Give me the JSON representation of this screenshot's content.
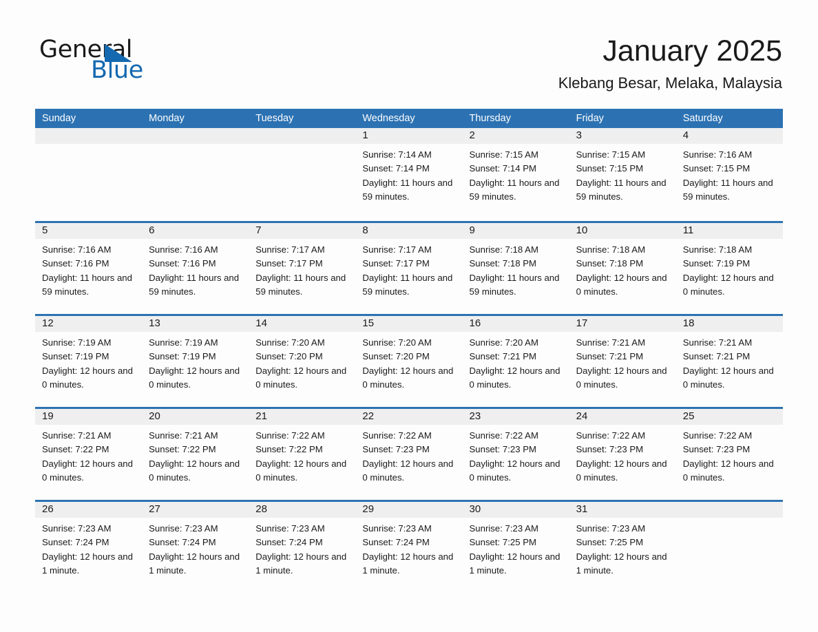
{
  "brand": {
    "name_part1": "General",
    "name_part2": "Blue",
    "triangle_icon": "triangle-icon",
    "accent_color": "#1469b0"
  },
  "header": {
    "month_title": "January 2025",
    "location": "Klebang Besar, Melaka, Malaysia"
  },
  "theme": {
    "header_blue": "#2c72b3",
    "day_band_gray": "#efefef",
    "page_background": "#fdfdfd",
    "text_color": "#1a1a1a"
  },
  "calendar": {
    "weekdays": [
      "Sunday",
      "Monday",
      "Tuesday",
      "Wednesday",
      "Thursday",
      "Friday",
      "Saturday"
    ],
    "weeks": [
      [
        {
          "day": "",
          "sunrise": "",
          "sunset": "",
          "daylight": "",
          "empty": true
        },
        {
          "day": "",
          "sunrise": "",
          "sunset": "",
          "daylight": "",
          "empty": true
        },
        {
          "day": "",
          "sunrise": "",
          "sunset": "",
          "daylight": "",
          "empty": true
        },
        {
          "day": "1",
          "sunrise": "Sunrise: 7:14 AM",
          "sunset": "Sunset: 7:14 PM",
          "daylight": "Daylight: 11 hours and 59 minutes.",
          "empty": false
        },
        {
          "day": "2",
          "sunrise": "Sunrise: 7:15 AM",
          "sunset": "Sunset: 7:14 PM",
          "daylight": "Daylight: 11 hours and 59 minutes.",
          "empty": false
        },
        {
          "day": "3",
          "sunrise": "Sunrise: 7:15 AM",
          "sunset": "Sunset: 7:15 PM",
          "daylight": "Daylight: 11 hours and 59 minutes.",
          "empty": false
        },
        {
          "day": "4",
          "sunrise": "Sunrise: 7:16 AM",
          "sunset": "Sunset: 7:15 PM",
          "daylight": "Daylight: 11 hours and 59 minutes.",
          "empty": false
        }
      ],
      [
        {
          "day": "5",
          "sunrise": "Sunrise: 7:16 AM",
          "sunset": "Sunset: 7:16 PM",
          "daylight": "Daylight: 11 hours and 59 minutes.",
          "empty": false
        },
        {
          "day": "6",
          "sunrise": "Sunrise: 7:16 AM",
          "sunset": "Sunset: 7:16 PM",
          "daylight": "Daylight: 11 hours and 59 minutes.",
          "empty": false
        },
        {
          "day": "7",
          "sunrise": "Sunrise: 7:17 AM",
          "sunset": "Sunset: 7:17 PM",
          "daylight": "Daylight: 11 hours and 59 minutes.",
          "empty": false
        },
        {
          "day": "8",
          "sunrise": "Sunrise: 7:17 AM",
          "sunset": "Sunset: 7:17 PM",
          "daylight": "Daylight: 11 hours and 59 minutes.",
          "empty": false
        },
        {
          "day": "9",
          "sunrise": "Sunrise: 7:18 AM",
          "sunset": "Sunset: 7:18 PM",
          "daylight": "Daylight: 11 hours and 59 minutes.",
          "empty": false
        },
        {
          "day": "10",
          "sunrise": "Sunrise: 7:18 AM",
          "sunset": "Sunset: 7:18 PM",
          "daylight": "Daylight: 12 hours and 0 minutes.",
          "empty": false
        },
        {
          "day": "11",
          "sunrise": "Sunrise: 7:18 AM",
          "sunset": "Sunset: 7:19 PM",
          "daylight": "Daylight: 12 hours and 0 minutes.",
          "empty": false
        }
      ],
      [
        {
          "day": "12",
          "sunrise": "Sunrise: 7:19 AM",
          "sunset": "Sunset: 7:19 PM",
          "daylight": "Daylight: 12 hours and 0 minutes.",
          "empty": false
        },
        {
          "day": "13",
          "sunrise": "Sunrise: 7:19 AM",
          "sunset": "Sunset: 7:19 PM",
          "daylight": "Daylight: 12 hours and 0 minutes.",
          "empty": false
        },
        {
          "day": "14",
          "sunrise": "Sunrise: 7:20 AM",
          "sunset": "Sunset: 7:20 PM",
          "daylight": "Daylight: 12 hours and 0 minutes.",
          "empty": false
        },
        {
          "day": "15",
          "sunrise": "Sunrise: 7:20 AM",
          "sunset": "Sunset: 7:20 PM",
          "daylight": "Daylight: 12 hours and 0 minutes.",
          "empty": false
        },
        {
          "day": "16",
          "sunrise": "Sunrise: 7:20 AM",
          "sunset": "Sunset: 7:21 PM",
          "daylight": "Daylight: 12 hours and 0 minutes.",
          "empty": false
        },
        {
          "day": "17",
          "sunrise": "Sunrise: 7:21 AM",
          "sunset": "Sunset: 7:21 PM",
          "daylight": "Daylight: 12 hours and 0 minutes.",
          "empty": false
        },
        {
          "day": "18",
          "sunrise": "Sunrise: 7:21 AM",
          "sunset": "Sunset: 7:21 PM",
          "daylight": "Daylight: 12 hours and 0 minutes.",
          "empty": false
        }
      ],
      [
        {
          "day": "19",
          "sunrise": "Sunrise: 7:21 AM",
          "sunset": "Sunset: 7:22 PM",
          "daylight": "Daylight: 12 hours and 0 minutes.",
          "empty": false
        },
        {
          "day": "20",
          "sunrise": "Sunrise: 7:21 AM",
          "sunset": "Sunset: 7:22 PM",
          "daylight": "Daylight: 12 hours and 0 minutes.",
          "empty": false
        },
        {
          "day": "21",
          "sunrise": "Sunrise: 7:22 AM",
          "sunset": "Sunset: 7:22 PM",
          "daylight": "Daylight: 12 hours and 0 minutes.",
          "empty": false
        },
        {
          "day": "22",
          "sunrise": "Sunrise: 7:22 AM",
          "sunset": "Sunset: 7:23 PM",
          "daylight": "Daylight: 12 hours and 0 minutes.",
          "empty": false
        },
        {
          "day": "23",
          "sunrise": "Sunrise: 7:22 AM",
          "sunset": "Sunset: 7:23 PM",
          "daylight": "Daylight: 12 hours and 0 minutes.",
          "empty": false
        },
        {
          "day": "24",
          "sunrise": "Sunrise: 7:22 AM",
          "sunset": "Sunset: 7:23 PM",
          "daylight": "Daylight: 12 hours and 0 minutes.",
          "empty": false
        },
        {
          "day": "25",
          "sunrise": "Sunrise: 7:22 AM",
          "sunset": "Sunset: 7:23 PM",
          "daylight": "Daylight: 12 hours and 0 minutes.",
          "empty": false
        }
      ],
      [
        {
          "day": "26",
          "sunrise": "Sunrise: 7:23 AM",
          "sunset": "Sunset: 7:24 PM",
          "daylight": "Daylight: 12 hours and 1 minute.",
          "empty": false
        },
        {
          "day": "27",
          "sunrise": "Sunrise: 7:23 AM",
          "sunset": "Sunset: 7:24 PM",
          "daylight": "Daylight: 12 hours and 1 minute.",
          "empty": false
        },
        {
          "day": "28",
          "sunrise": "Sunrise: 7:23 AM",
          "sunset": "Sunset: 7:24 PM",
          "daylight": "Daylight: 12 hours and 1 minute.",
          "empty": false
        },
        {
          "day": "29",
          "sunrise": "Sunrise: 7:23 AM",
          "sunset": "Sunset: 7:24 PM",
          "daylight": "Daylight: 12 hours and 1 minute.",
          "empty": false
        },
        {
          "day": "30",
          "sunrise": "Sunrise: 7:23 AM",
          "sunset": "Sunset: 7:25 PM",
          "daylight": "Daylight: 12 hours and 1 minute.",
          "empty": false
        },
        {
          "day": "31",
          "sunrise": "Sunrise: 7:23 AM",
          "sunset": "Sunset: 7:25 PM",
          "daylight": "Daylight: 12 hours and 1 minute.",
          "empty": false
        },
        {
          "day": "",
          "sunrise": "",
          "sunset": "",
          "daylight": "",
          "empty": true
        }
      ]
    ]
  }
}
